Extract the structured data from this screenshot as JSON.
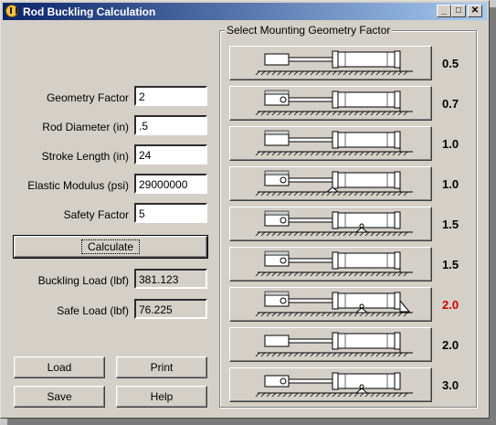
{
  "window": {
    "title": "Rod Buckling Calculation"
  },
  "inputs": {
    "geometry_factor": {
      "label": "Geometry Factor",
      "value": "2"
    },
    "rod_diameter": {
      "label": "Rod Diameter (in)",
      "value": ".5"
    },
    "stroke_length": {
      "label": "Stroke Length (in)",
      "value": "24"
    },
    "elastic_modulus": {
      "label": "Elastic Modulus (psi)",
      "value": "29000000"
    },
    "safety_factor": {
      "label": "Safety Factor",
      "value": "5"
    }
  },
  "calculate_label": "Calculate",
  "outputs": {
    "buckling_load": {
      "label": "Buckling Load (lbf)",
      "value": "381.123"
    },
    "safe_load": {
      "label": "Safe Load (lbf)",
      "value": "76.225"
    }
  },
  "buttons": {
    "load": "Load",
    "print": "Print",
    "save": "Save",
    "help": "Help"
  },
  "geometry": {
    "title": "Select Mounting Geometry Factor",
    "options": [
      {
        "factor": "0.5",
        "icon": "rod-clamped-cylinder-fixed-icon",
        "selected": false
      },
      {
        "factor": "0.7",
        "icon": "rod-pinned-cylinder-fixed-icon",
        "selected": false
      },
      {
        "factor": "1.0",
        "icon": "rod-guided-cylinder-flange-icon",
        "selected": false
      },
      {
        "factor": "1.0",
        "icon": "rod-pinned-cylinder-pinned-icon",
        "selected": false
      },
      {
        "factor": "1.5",
        "icon": "rod-clamped-cylinder-clevis-icon",
        "selected": false
      },
      {
        "factor": "1.5",
        "icon": "rod-clamped-cylinder-free-icon",
        "selected": false
      },
      {
        "factor": "2.0",
        "icon": "rod-pinned-cylinder-trunnion-icon",
        "selected": true
      },
      {
        "factor": "2.0",
        "icon": "rod-free-cylinder-fixed-icon",
        "selected": false
      },
      {
        "factor": "3.0",
        "icon": "rod-free-cylinder-pinned-icon",
        "selected": false
      }
    ]
  }
}
